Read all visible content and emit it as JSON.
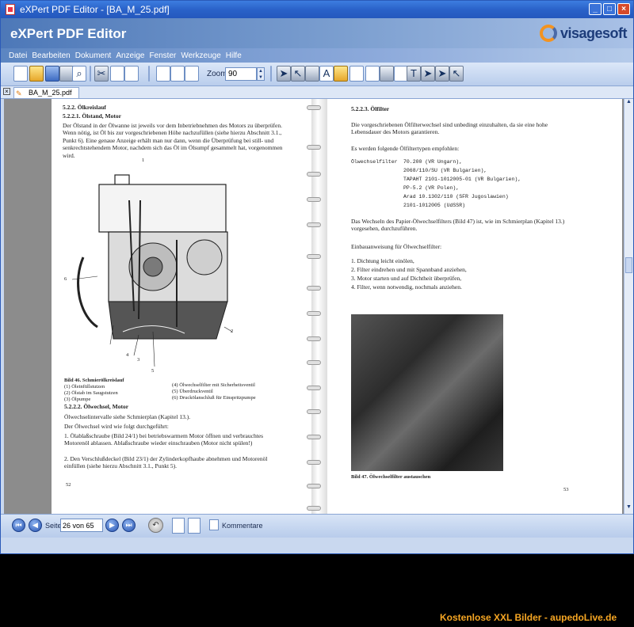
{
  "window": {
    "title": "eXPert PDF Editor - [BA_M_25.pdf]"
  },
  "header": {
    "app_title": "eXPert PDF Editor",
    "brand": "visagesoft"
  },
  "menu": {
    "items": [
      "Datei",
      "Bearbeiten",
      "Dokument",
      "Anzeige",
      "Fenster",
      "Werkzeuge",
      "Hilfe"
    ]
  },
  "toolbar": {
    "zoom_label": "Zoom",
    "zoom_value": "90"
  },
  "tab": {
    "label": "BA_M_25.pdf"
  },
  "document": {
    "left": {
      "h1": "5.2.2.   Ölkreislauf",
      "h2": "5.2.2.1.   Ölstand, Motor",
      "p1": "Der Ölstand in der Ölwanne ist jeweils vor dem Inbetriebnehmen des Motors zu überprüfen. Wenn nötig, ist Öl bis zur vorgeschriebenen Höhe nachzufüllen (siehe hierzu Abschnitt 3.1., Punkt 6). Eine genaue Anzeige erhält man nur dann, wenn die Überprüfung bei still- und senkrechtstehendem Motor, nachdem sich das Öl im Ölsumpf gesammelt hat, vorgenommen wird.",
      "callout_1": "1",
      "callout_2": "2",
      "callout_3": "3",
      "callout_4": "4",
      "callout_5": "5",
      "callout_6": "6",
      "caption_title": "Bild 46. Schmierölkreislauf",
      "caption_l1": "(1) Öleinfüllstutzen",
      "caption_l2": "(2) Ölstab im Saugstutzen",
      "caption_l3": "(3) Ölpumpe",
      "caption_r1": "(4) Ölwechselfilter mit Sicherheitsventil",
      "caption_r2": "(5) Überdruckventil",
      "caption_r3": "(6) Druckölanschluß für Einspritzpumpe",
      "h3": "5.2.2.2.   Ölwechsel, Motor",
      "p2": "Ölwechselintervalle siehe Schmierplan (Kapitel 13.).",
      "p3": "Der Ölwechsel wird wie folgt durchgeführt:",
      "step1": "1.  Ölablaßschraube (Bild 24/1) bei betriebswarmem Motor öffnen und verbrauchtes Motorenöl ablassen. Ablaßschraube wieder einschrauben (Motor nicht spülen!)",
      "step2": "2.  Den Verschlußdeckel (Bild 23/1) der Zylinderkopfhaube abnehmen und Motorenöl einfüllen (siehe hierzu Abschnitt 3.1., Punkt 5).",
      "page_no": "52"
    },
    "right": {
      "h1": "5.2.2.3.   Ölfilter",
      "p1": "Die vorgeschriebenen Ölfilterwechsel sind unbedingt einzuhalten, da sie eine hohe Lebensdauer des Motors garantieren.",
      "p2": "Es werden folgende Ölfiltertypen empfohlen:",
      "filter_label": "Ölwechselfilter",
      "filters": [
        "70.200 (VR Ungarn),",
        "2068/110/SU (VR Bulgarien),",
        "TAPAHT 2101-1012005-01 (VR Bulgarien),",
        "PP-5.2 (VR Polen),",
        "Arad 10.1302/110 (SFR Jugoslawien)",
        "2101-1012005 (UdSSR)"
      ],
      "p3": "Das Wechseln des Papier-Ölwechselfilters (Bild 47) ist, wie im Schmierplan (Kapitel 13.) vorgesehen, durchzuführen.",
      "p4": "Einbauanweisung für Ölwechselfilter:",
      "steps": [
        "1.  Dichtung leicht einölen,",
        "2.  Filter eindrehen und mit Spannband anziehen,",
        "3.  Motor starten und auf Dichtheit überprüfen,",
        "4.  Filter, wenn notwendig, nochmals anziehen."
      ],
      "photo_caption": "Bild 47. Ölwechselfilter austauschen",
      "page_no": "53"
    }
  },
  "status": {
    "page_label": "Seite",
    "page_value": "26 von 65",
    "comments_label": "Kommentare"
  },
  "watermark": "Kostenlose XXL Bilder - aupedoLive.de",
  "colors": {
    "accent": "#2a62c9",
    "brand_orange": "#f39320",
    "watermark": "#f6a623"
  }
}
